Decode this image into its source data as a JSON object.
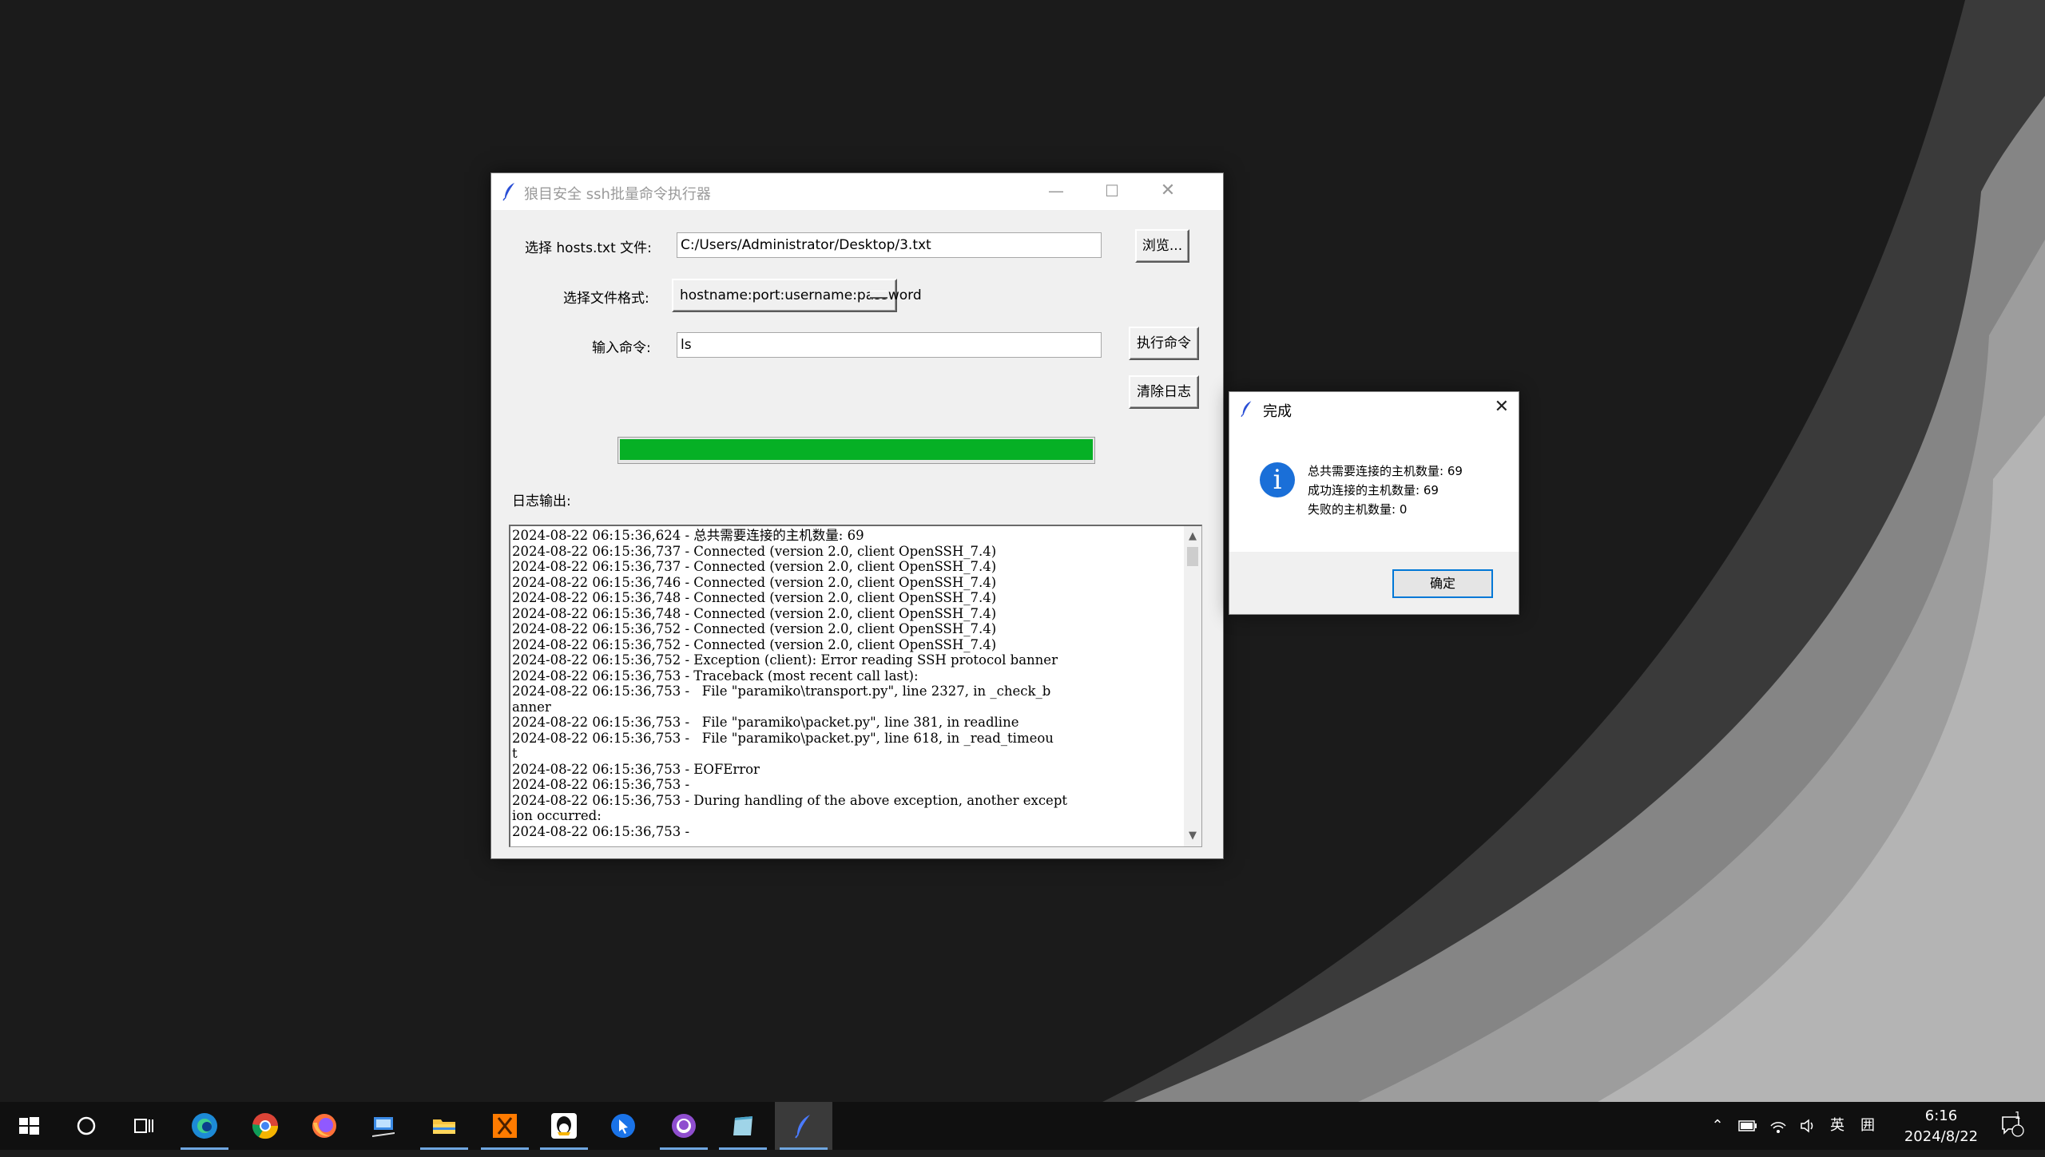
{
  "main_window": {
    "title": "狼目安全 ssh批量命令执行器",
    "min_glyph": "—",
    "max_glyph": "☐",
    "close_glyph": "✕",
    "hosts_label": "选择 hosts.txt 文件:",
    "hosts_path": "C:/Users/Administrator/Desktop/3.txt",
    "browse_button": "浏览...",
    "format_label": "选择文件格式:",
    "format_value": "hostname:port:username:password",
    "command_label": "输入命令:",
    "command_value": "ls",
    "execute_button": "执行命令",
    "clear_button": "清除日志",
    "progress_percent": 100,
    "log_label": "日志输出:",
    "log_lines": [
      "2024-08-22 06:15:36,624 - 总共需要连接的主机数量: 69",
      "2024-08-22 06:15:36,737 - Connected (version 2.0, client OpenSSH_7.4)",
      "2024-08-22 06:15:36,737 - Connected (version 2.0, client OpenSSH_7.4)",
      "2024-08-22 06:15:36,746 - Connected (version 2.0, client OpenSSH_7.4)",
      "2024-08-22 06:15:36,748 - Connected (version 2.0, client OpenSSH_7.4)",
      "2024-08-22 06:15:36,748 - Connected (version 2.0, client OpenSSH_7.4)",
      "2024-08-22 06:15:36,752 - Connected (version 2.0, client OpenSSH_7.4)",
      "2024-08-22 06:15:36,752 - Connected (version 2.0, client OpenSSH_7.4)",
      "2024-08-22 06:15:36,752 - Exception (client): Error reading SSH protocol banner",
      "2024-08-22 06:15:36,753 - Traceback (most recent call last):",
      "2024-08-22 06:15:36,753 -   File \"paramiko\\transport.py\", line 2327, in _check_b",
      "anner",
      "2024-08-22 06:15:36,753 -   File \"paramiko\\packet.py\", line 381, in readline",
      "2024-08-22 06:15:36,753 -   File \"paramiko\\packet.py\", line 618, in _read_timeou",
      "t",
      "2024-08-22 06:15:36,753 - EOFError",
      "2024-08-22 06:15:36,753 -",
      "2024-08-22 06:15:36,753 - During handling of the above exception, another except",
      "ion occurred:",
      "2024-08-22 06:15:36,753 -"
    ]
  },
  "dialog": {
    "title": "完成",
    "close_glyph": "✕",
    "info_glyph": "i",
    "line1": "总共需要连接的主机数量: 69",
    "line2": "成功连接的主机数量: 69",
    "line3": "失败的主机数量: 0",
    "ok_button": "确定"
  },
  "taskbar": {
    "apps": [
      "start",
      "search",
      "task-view",
      "edge",
      "chrome",
      "firefox",
      "remote-desktop",
      "file-explorer",
      "xshell",
      "qq",
      "teamviewer",
      "github",
      "notepad",
      "python-tk"
    ],
    "tray": {
      "ime": "英",
      "ime_mode": "囲",
      "time": "6:16",
      "date": "2024/8/22",
      "notification_count": "1"
    }
  },
  "colors": {
    "progress_fill": "#06b025",
    "accent": "#0078d7",
    "info_icon": "#1a6fd8"
  }
}
